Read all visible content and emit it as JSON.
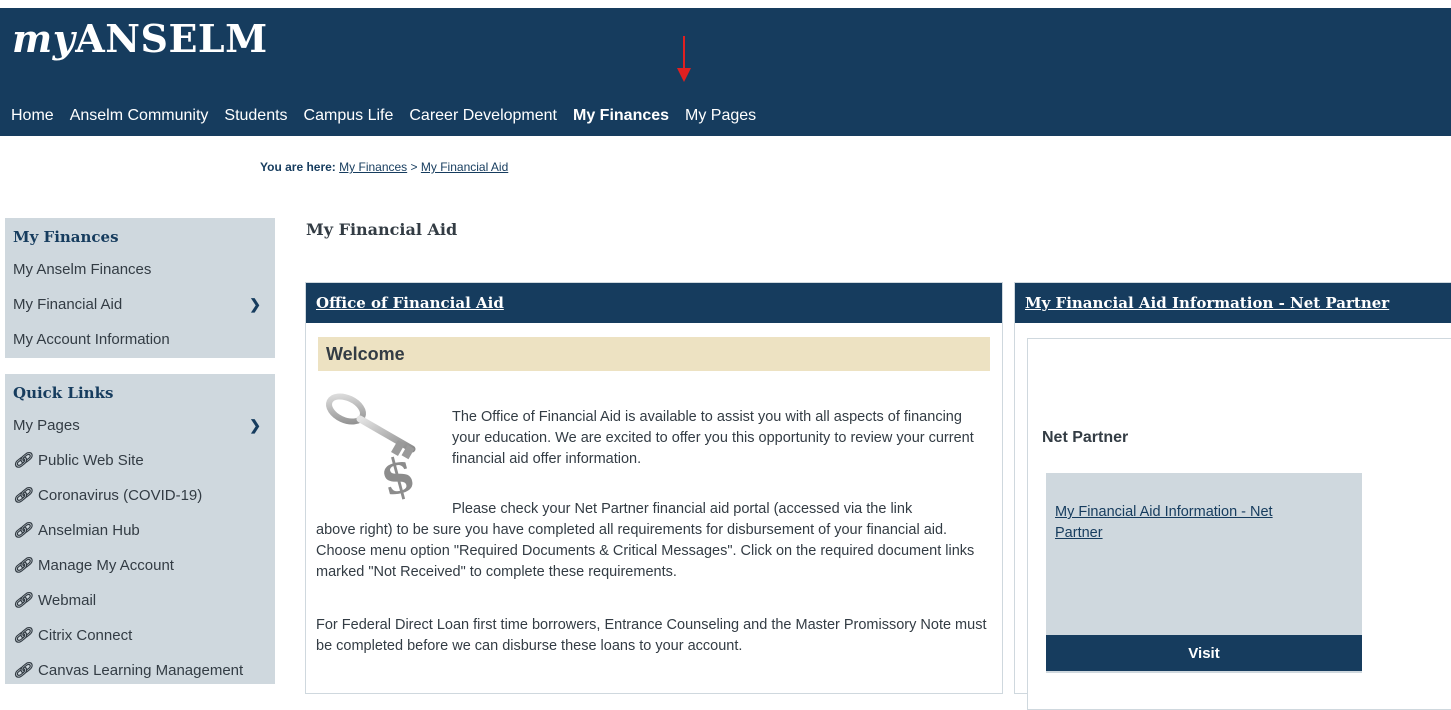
{
  "header": {
    "logo_my": "my",
    "logo_rest": "ANSELM",
    "nav": [
      "Home",
      "Anselm Community",
      "Students",
      "Campus Life",
      "Career Development",
      "My Finances",
      "My Pages"
    ]
  },
  "breadcrumb": {
    "prefix": "You are here:",
    "items": [
      "My Finances",
      "My Financial Aid"
    ],
    "separator": ">"
  },
  "sidebar": {
    "finances": {
      "title": "My Finances",
      "items": [
        "My Anselm Finances",
        "My Financial Aid",
        "My Account Information"
      ]
    },
    "quick_links": {
      "title": "Quick Links",
      "items": [
        "My Pages",
        "Public Web Site",
        "Coronavirus (COVID-19)",
        "Anselmian Hub",
        "Manage My Account",
        "Webmail",
        "Citrix Connect",
        "Canvas Learning Management"
      ]
    }
  },
  "main": {
    "page_title": "My Financial Aid",
    "office_panel": {
      "title": "Office of Financial Aid",
      "welcome": "Welcome",
      "p1": "The Office of Financial Aid is available to assist you with all aspects of financing your education.  We are excited to offer you this opportunity to review your current financial aid offer information.",
      "p2a": "Please check your Net Partner financial aid portal (accessed via the link",
      "p2b": "above right) to be sure you have completed all requirements for disbursement of your financial aid.  Choose menu option \"Required Documents & Critical Messages\".  Click on the required document links marked \"Not Received\" to complete these requirements.",
      "p3": "For Federal Direct Loan first time borrowers, Entrance Counseling and the Master Promissory Note must be completed before we can disburse these loans to your account."
    },
    "net_partner_panel": {
      "title": "My Financial Aid Information - Net Partner",
      "heading": "Net Partner",
      "link": "My Financial Aid Information - Net Partner",
      "visit": "Visit"
    }
  },
  "colors": {
    "navy": "#163c5e",
    "sidebar_bg": "#cfd8de",
    "welcome_bg": "#ede2c2",
    "annotation_red": "#e02020"
  },
  "icons": [
    "chevron-down-icon",
    "link-icon",
    "key-icon",
    "red-arrow-annotation"
  ]
}
